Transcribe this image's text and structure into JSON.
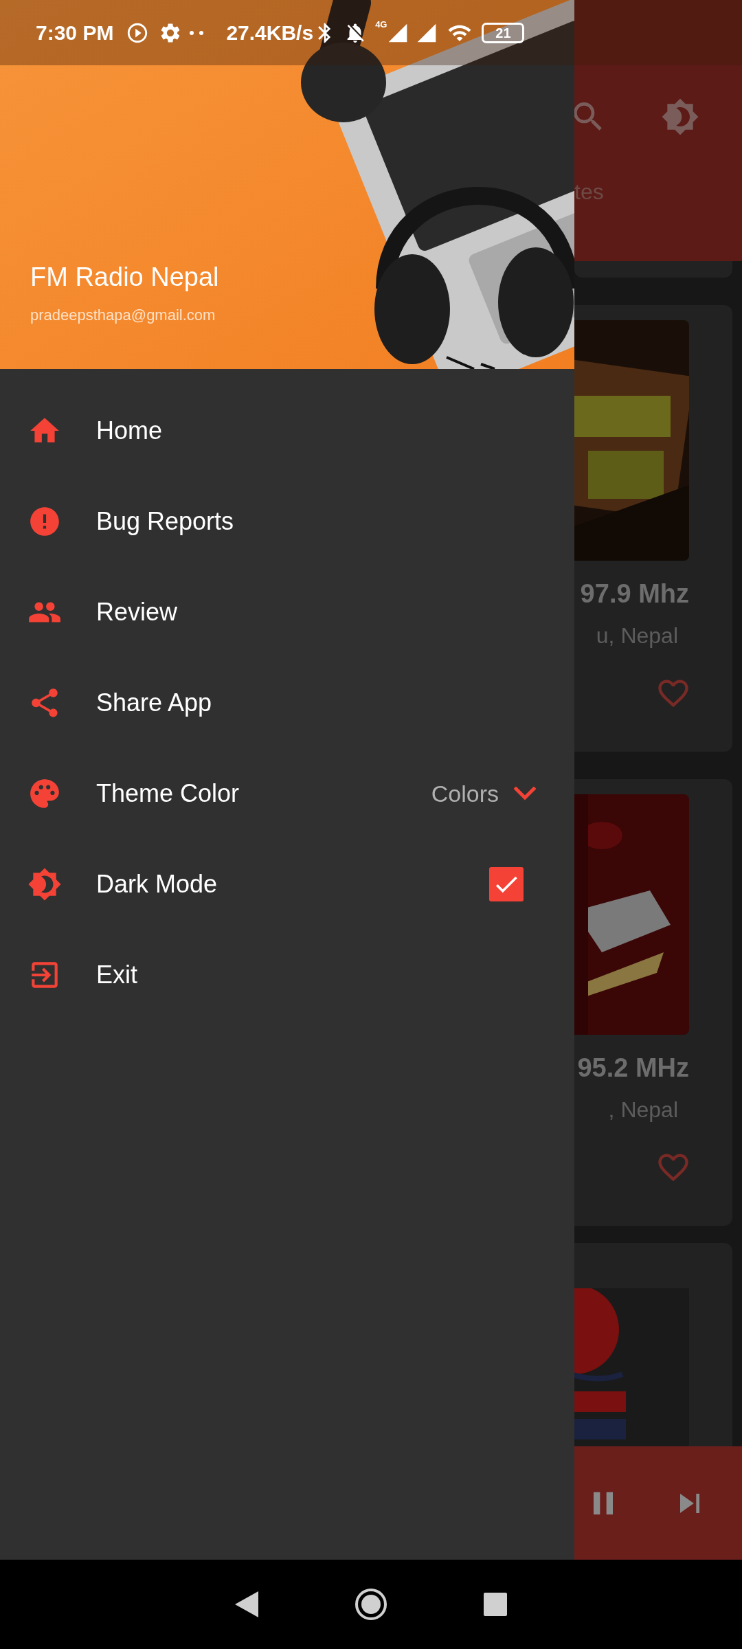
{
  "status_bar": {
    "time": "7:30 PM",
    "speed": "27.4KB/s",
    "network": "4G",
    "battery": "21"
  },
  "drawer": {
    "header": {
      "title": "FM Radio Nepal",
      "email": "pradeepsthapa@gmail.com"
    },
    "items": [
      {
        "kind": "link",
        "label": "Home"
      },
      {
        "kind": "link",
        "label": "Bug Reports"
      },
      {
        "kind": "link",
        "label": "Review"
      },
      {
        "kind": "link",
        "label": "Share App"
      },
      {
        "kind": "dropdown",
        "label": "Theme Color",
        "value": "Colors"
      },
      {
        "kind": "checkbox",
        "label": "Dark Mode",
        "checked": true
      },
      {
        "kind": "link",
        "label": "Exit"
      }
    ]
  },
  "background": {
    "tab": "tes",
    "stations": [
      {
        "frequency": "97.9 Mhz",
        "location": "u, Nepal"
      },
      {
        "frequency": "95.2 MHz",
        "location": ", Nepal"
      }
    ]
  }
}
